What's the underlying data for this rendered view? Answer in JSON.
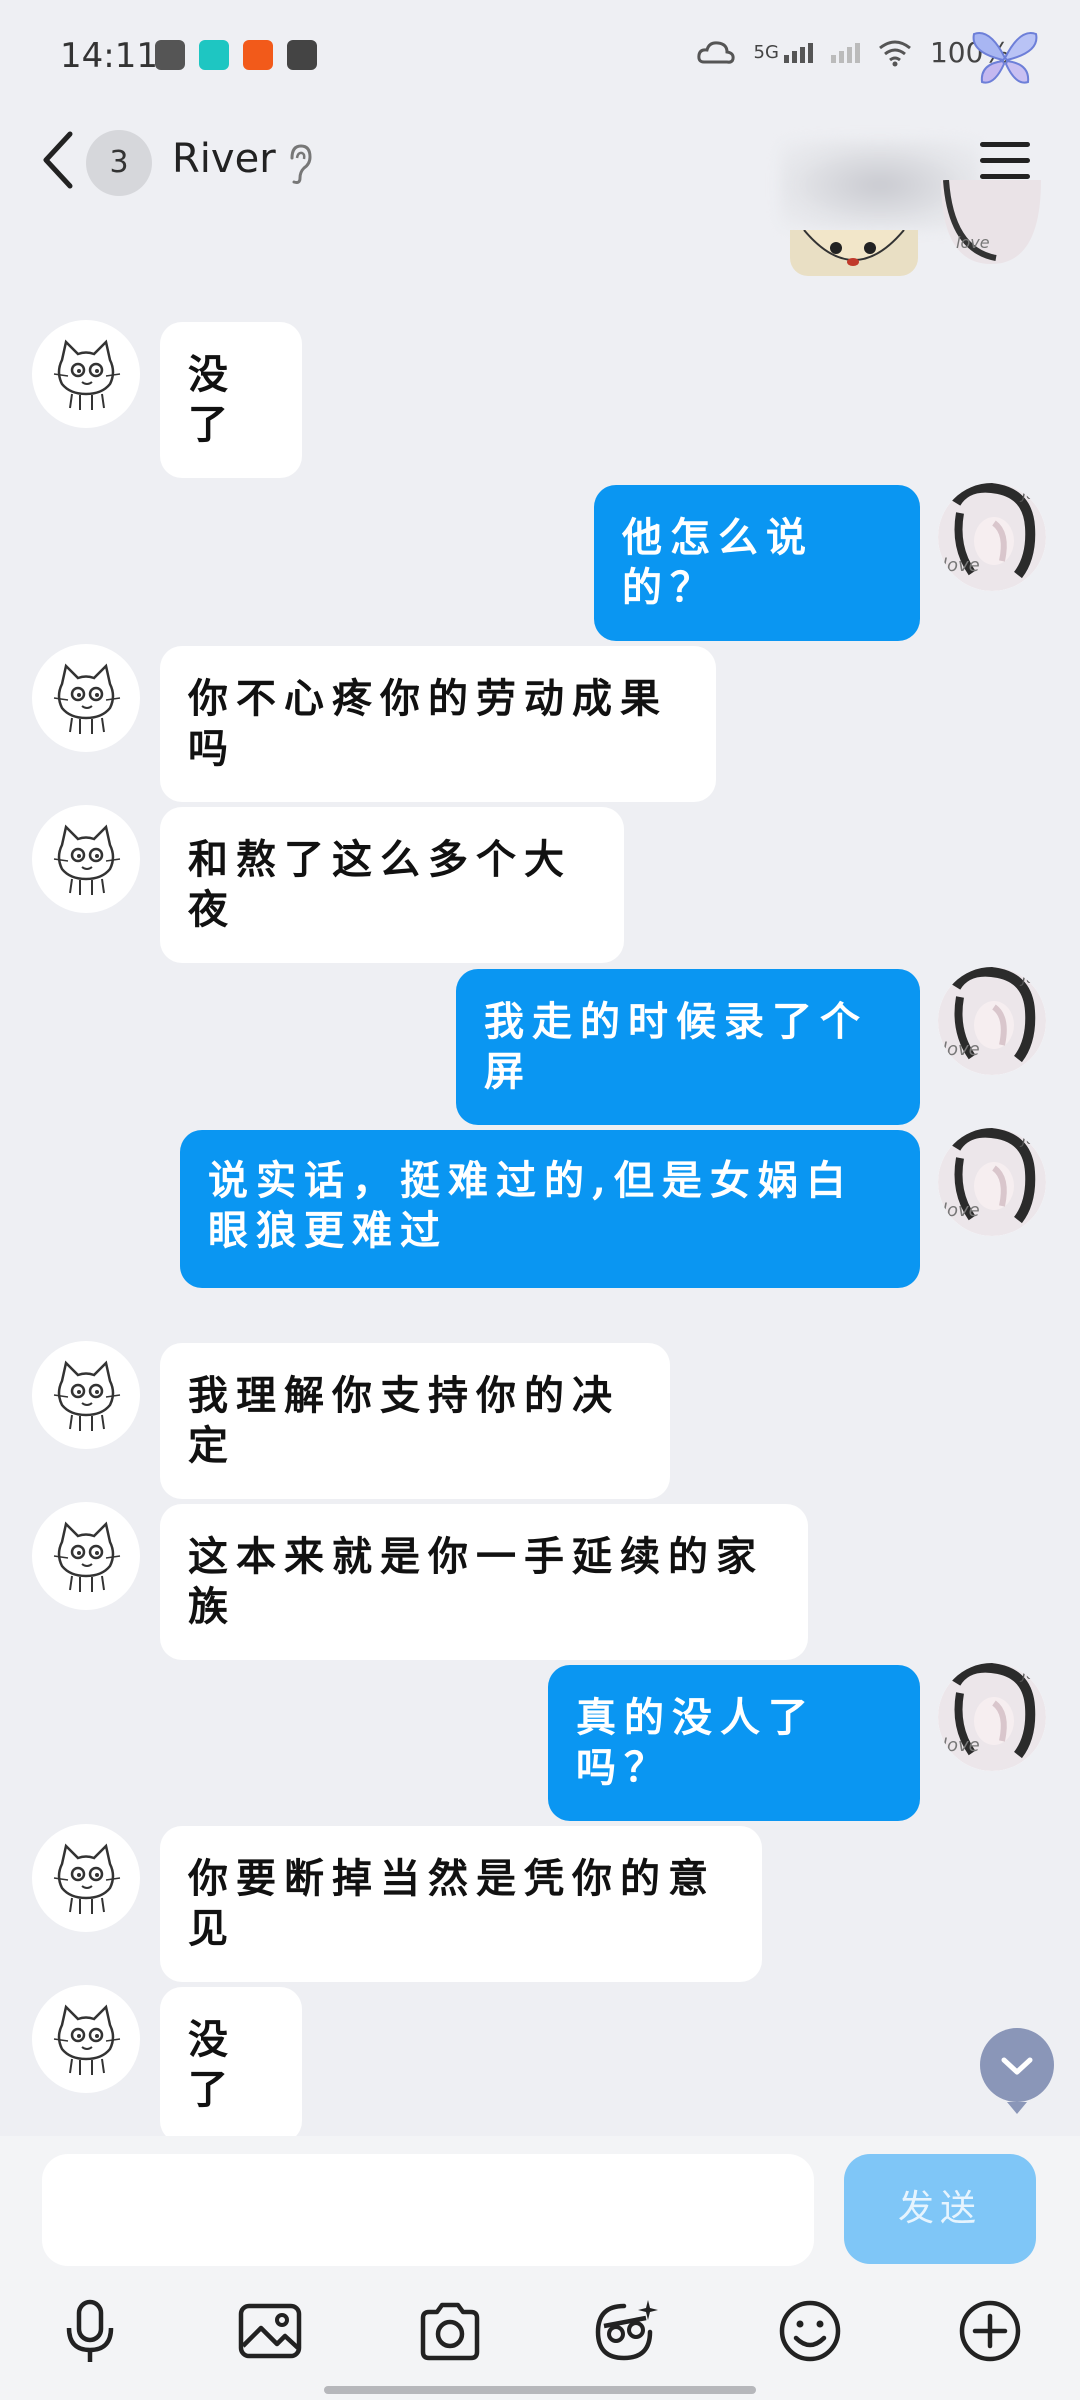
{
  "status_bar": {
    "time": "14:11",
    "network": "5G",
    "battery": "100%"
  },
  "header": {
    "unread_count": "3",
    "contact_name": "River"
  },
  "messages": [
    {
      "side": "in",
      "text": "没了"
    },
    {
      "side": "out",
      "text": "他怎么说的？"
    },
    {
      "side": "in",
      "text": "你不心疼你的劳动成果吗"
    },
    {
      "side": "in",
      "text": "和熬了这么多个大夜"
    },
    {
      "side": "out",
      "text": "我走的时候录了个屏"
    },
    {
      "side": "out",
      "text": "说实话，挺难过的,但是女娲白眼狼更难过"
    },
    {
      "side": "in",
      "text": "我理解你支持你的决定"
    },
    {
      "side": "in",
      "text": "这本来就是你一手延续的家族"
    },
    {
      "side": "out",
      "text": "真的没人了吗？"
    },
    {
      "side": "in",
      "text": "你要断掉当然是凭你的意见"
    },
    {
      "side": "in",
      "text": "没了"
    }
  ],
  "composer": {
    "placeholder": "",
    "send_label": "发送"
  },
  "toolbar": [
    "microphone-icon",
    "image-icon",
    "camera-icon",
    "sticker-icon",
    "emoji-icon",
    "plus-icon"
  ],
  "colors": {
    "outgoing_bubble": "#0a96f2",
    "incoming_bubble": "#ffffff",
    "background": "#eeeff3",
    "send_button": "#7fc6f7"
  }
}
